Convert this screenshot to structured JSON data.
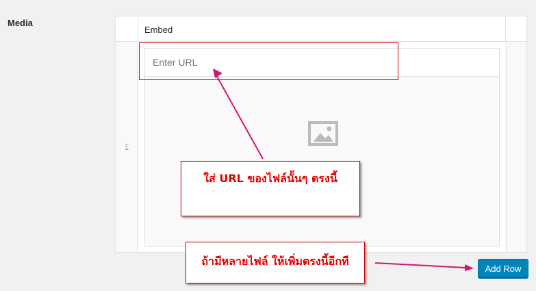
{
  "field": {
    "label": "Media"
  },
  "repeater": {
    "column_header": "Embed",
    "rows": [
      {
        "number": "1",
        "url_placeholder": "Enter URL",
        "url_value": ""
      }
    ],
    "add_row_label": "Add Row"
  },
  "annotations": {
    "url_note": "ใส่ URL ของไฟล์นั้นๆ ตรงนี้",
    "add_row_note": "ถ้ามีหลายไฟล์ ให้เพิ่มตรงนี้อีกที"
  },
  "icons": {
    "media_placeholder": "image-icon"
  },
  "colors": {
    "primary_button": "#0085ba",
    "annotation_red": "#e00000",
    "arrow_pink": "#d6136e"
  }
}
